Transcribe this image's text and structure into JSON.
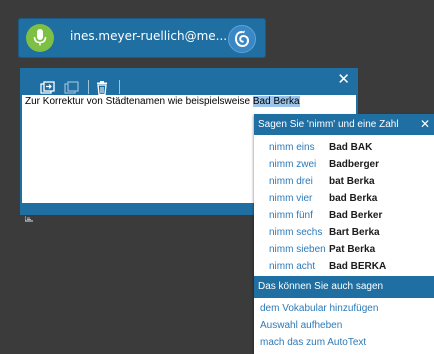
{
  "user_bar": {
    "email": "ines.meyer-ruellich@me..."
  },
  "dictation_box": {
    "close_glyph": "✕",
    "text_before": "Zur Korrektur von Städtenamen wie beispielsweise ",
    "text_selected": "Bad Berka"
  },
  "correction_menu": {
    "header": "Sagen Sie 'nimm' und eine Zahl",
    "close_glyph": "✕",
    "items": [
      {
        "command": "nimm eins",
        "word": "Bad BAK"
      },
      {
        "command": "nimm zwei",
        "word": "Badberger"
      },
      {
        "command": "nimm drei",
        "word": "bat Berka"
      },
      {
        "command": "nimm vier",
        "word": "bad Berka"
      },
      {
        "command": "nimm fünf",
        "word": "Bad Berker"
      },
      {
        "command": "nimm sechs",
        "word": "Bart Berka"
      },
      {
        "command": "nimm sieben",
        "word": "Pat Berka"
      },
      {
        "command": "nimm acht",
        "word": "Bad BERKA"
      }
    ],
    "also_header": "Das können Sie auch sagen",
    "also_items": [
      "dem Vokabular hinzufügen",
      "Auswahl aufheben",
      "mach das zum AutoText"
    ]
  },
  "colors": {
    "accent": "#1f6fa3",
    "mic_green": "#7dc043",
    "link_blue": "#2d7ab8",
    "selection": "#9cc4ea",
    "background": "#3b3b3b"
  },
  "icons": {
    "mic": "microphone-icon",
    "dragon": "dragon-logo-icon",
    "transfer": "transfer-text-icon",
    "transfer_disabled": "transfer-disabled-icon",
    "delete": "trash-icon"
  }
}
